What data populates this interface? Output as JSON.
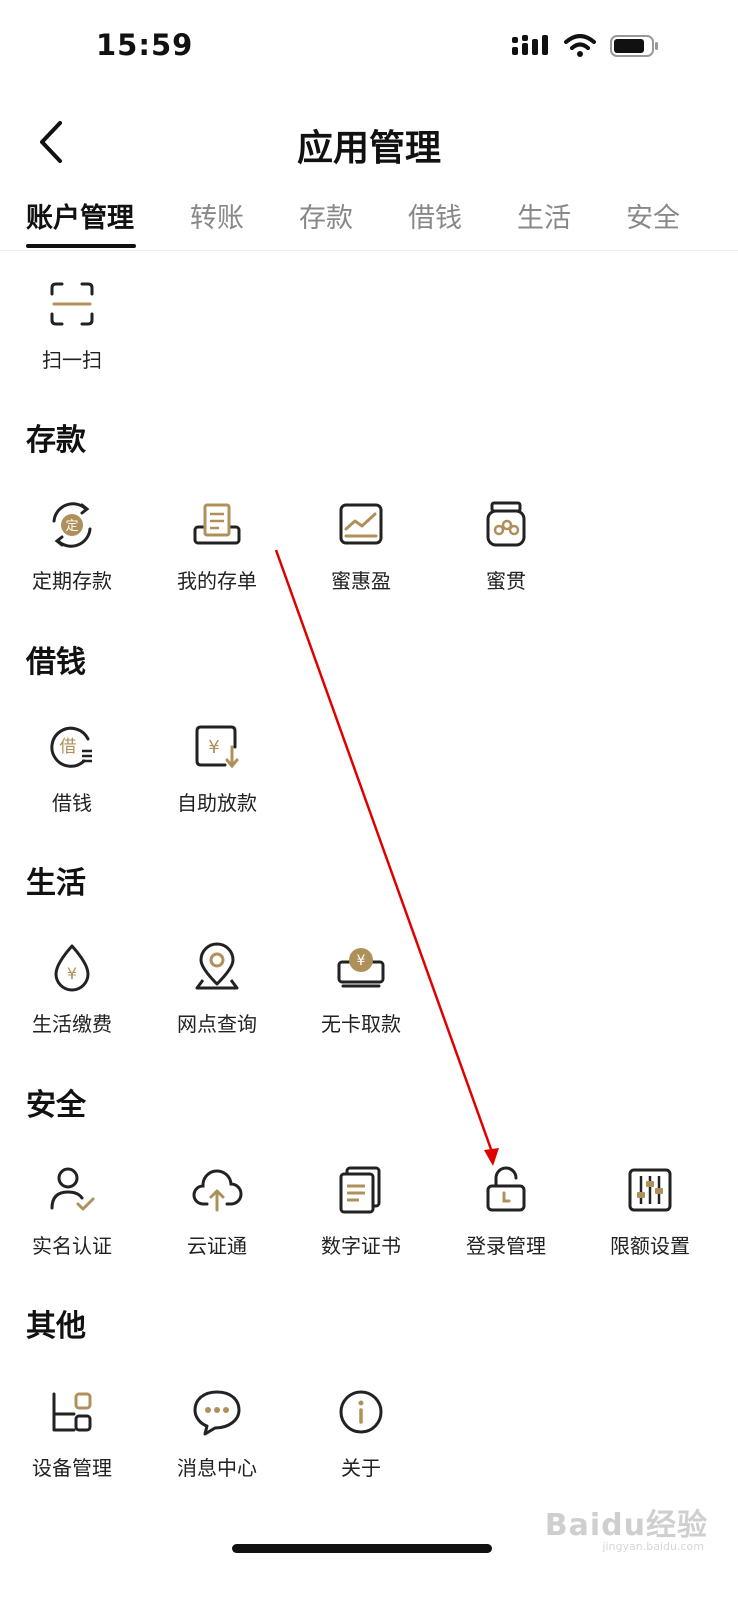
{
  "status": {
    "time": "15:59"
  },
  "header": {
    "title": "应用管理"
  },
  "tabs": [
    {
      "label": "账户管理",
      "active": true
    },
    {
      "label": "转账"
    },
    {
      "label": "存款"
    },
    {
      "label": "借钱"
    },
    {
      "label": "生活"
    },
    {
      "label": "安全"
    }
  ],
  "account": {
    "items": [
      {
        "label": "扫一扫",
        "icon": "scan-icon"
      }
    ]
  },
  "sections": [
    {
      "title": "存款",
      "items": [
        {
          "label": "定期存款",
          "icon": "fixed-deposit-icon"
        },
        {
          "label": "我的存单",
          "icon": "deposit-slip-icon"
        },
        {
          "label": "蜜惠盈",
          "icon": "chart-icon"
        },
        {
          "label": "蜜贯",
          "icon": "jar-icon"
        }
      ]
    },
    {
      "title": "借钱",
      "items": [
        {
          "label": "借钱",
          "icon": "borrow-icon"
        },
        {
          "label": "自助放款",
          "icon": "self-loan-icon"
        }
      ]
    },
    {
      "title": "生活",
      "items": [
        {
          "label": "生活缴费",
          "icon": "bill-payment-icon"
        },
        {
          "label": "网点查询",
          "icon": "location-icon"
        },
        {
          "label": "无卡取款",
          "icon": "cardless-withdrawal-icon"
        }
      ]
    },
    {
      "title": "安全",
      "items": [
        {
          "label": "实名认证",
          "icon": "user-verify-icon"
        },
        {
          "label": "云证通",
          "icon": "cloud-upload-icon"
        },
        {
          "label": "数字证书",
          "icon": "certificate-icon"
        },
        {
          "label": "登录管理",
          "icon": "lock-icon"
        },
        {
          "label": "限额设置",
          "icon": "sliders-icon"
        }
      ]
    },
    {
      "title": "其他",
      "items": [
        {
          "label": "设备管理",
          "icon": "device-icon"
        },
        {
          "label": "消息中心",
          "icon": "message-icon"
        },
        {
          "label": "关于",
          "icon": "info-icon"
        }
      ]
    }
  ],
  "watermark": {
    "text": "Baidu经验",
    "sub": "jingyan.baidu.com"
  },
  "colors": {
    "accent": "#b0905a",
    "text": "#222222",
    "arrow": "#e00000"
  }
}
